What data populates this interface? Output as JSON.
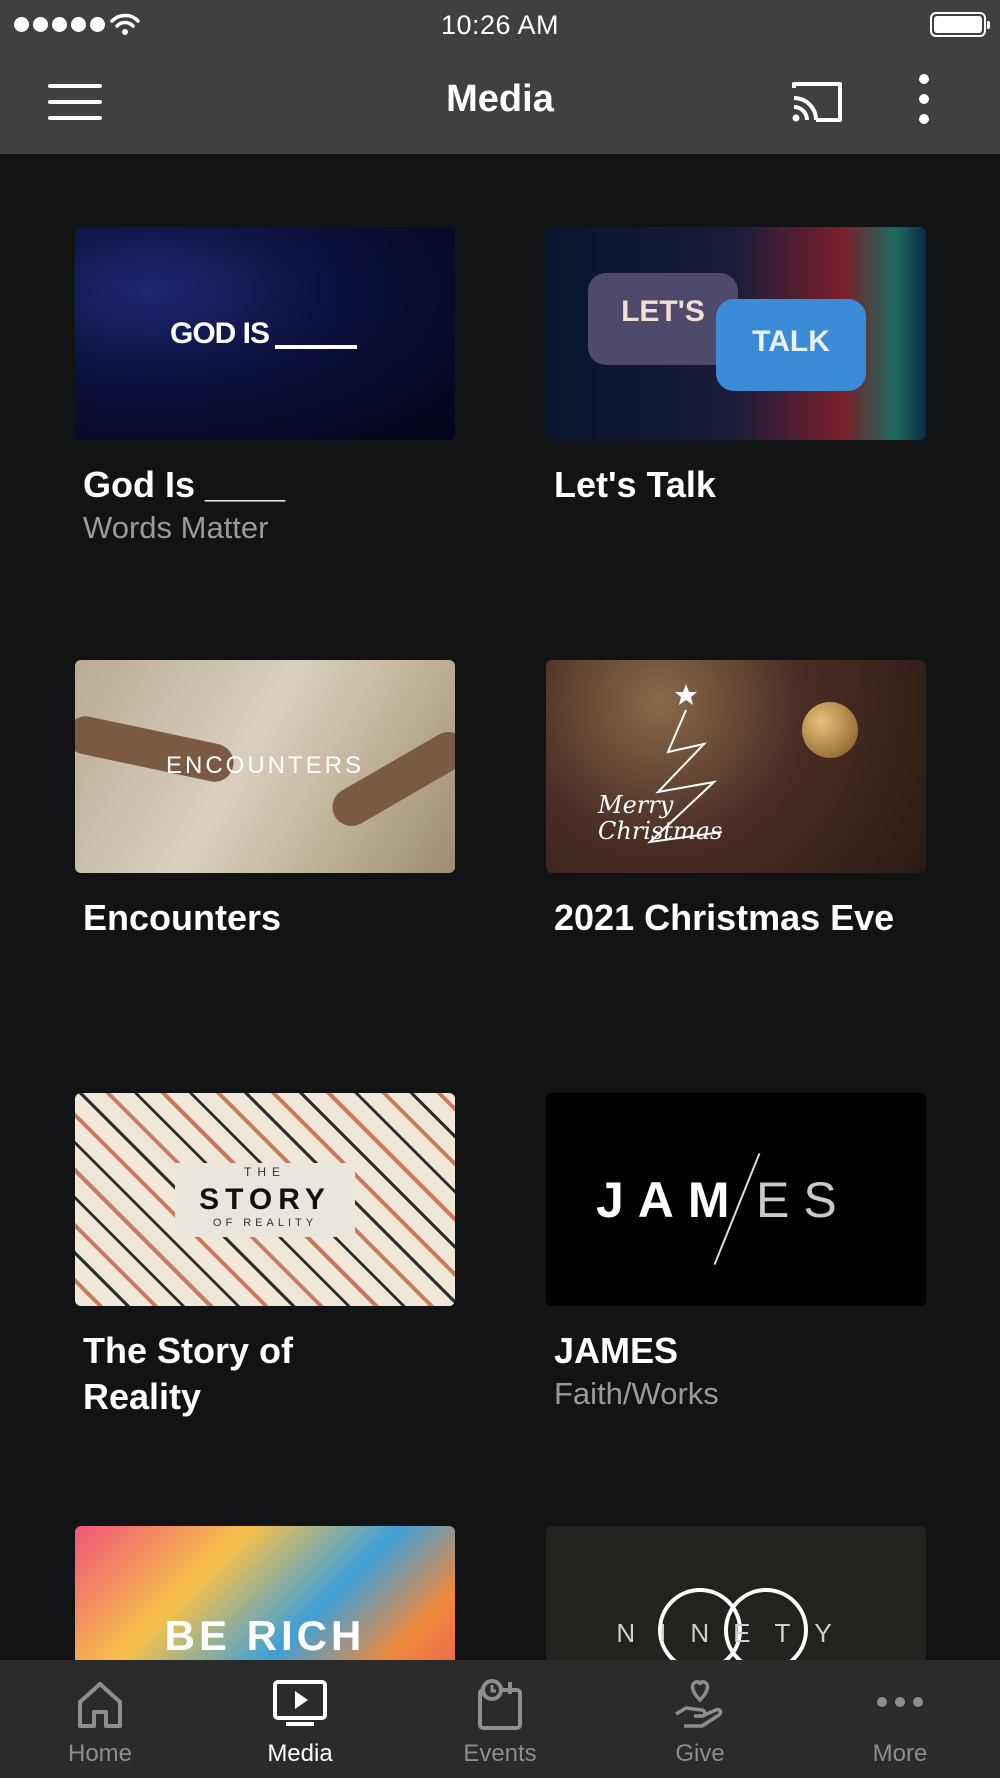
{
  "status_bar": {
    "time": "10:26 AM",
    "signal_bars": 5,
    "battery_level": 1.0
  },
  "nav": {
    "title": "Media",
    "menu_icon": "hamburger-menu-icon",
    "cast_icon": "cast-icon",
    "more_icon": "vertical-dots-icon"
  },
  "cards": [
    {
      "title": "God Is ____",
      "subtitle": "Words Matter",
      "art_text": "GOD IS"
    },
    {
      "title": "Let's Talk",
      "subtitle": "",
      "art_text_1": "LET'S",
      "art_text_2": "TALK"
    },
    {
      "title": "Encounters",
      "subtitle": "",
      "art_text": "ENCOUNTERS"
    },
    {
      "title": "2021 Christmas Eve",
      "subtitle": "",
      "art_text_1": "Merry",
      "art_text_2": "Christmas"
    },
    {
      "title": "The Story of Reality",
      "subtitle": "",
      "art_text_top": "THE",
      "art_text_main": "STORY",
      "art_text_bottom": "OF REALITY"
    },
    {
      "title": "JAMES",
      "subtitle": "Faith/Works",
      "art_text_1": "JAM",
      "art_text_2": "ES"
    },
    {
      "title": "",
      "subtitle": "",
      "art_text": "BE RICH"
    },
    {
      "title": "",
      "subtitle": "",
      "art_text": "NINETY"
    }
  ],
  "tabs": [
    {
      "label": "Home",
      "icon": "home-icon",
      "active": false
    },
    {
      "label": "Media",
      "icon": "play-screen-icon",
      "active": true
    },
    {
      "label": "Events",
      "icon": "calendar-clock-icon",
      "active": false
    },
    {
      "label": "Give",
      "icon": "hand-heart-icon",
      "active": false
    },
    {
      "label": "More",
      "icon": "horizontal-dots-icon",
      "active": false
    }
  ],
  "colors": {
    "background": "#121315",
    "bars": "#404040",
    "tab_bar": "#2b2b2c",
    "subtitle": "#9a9a9a",
    "inactive_tab": "#8e8e8e"
  }
}
